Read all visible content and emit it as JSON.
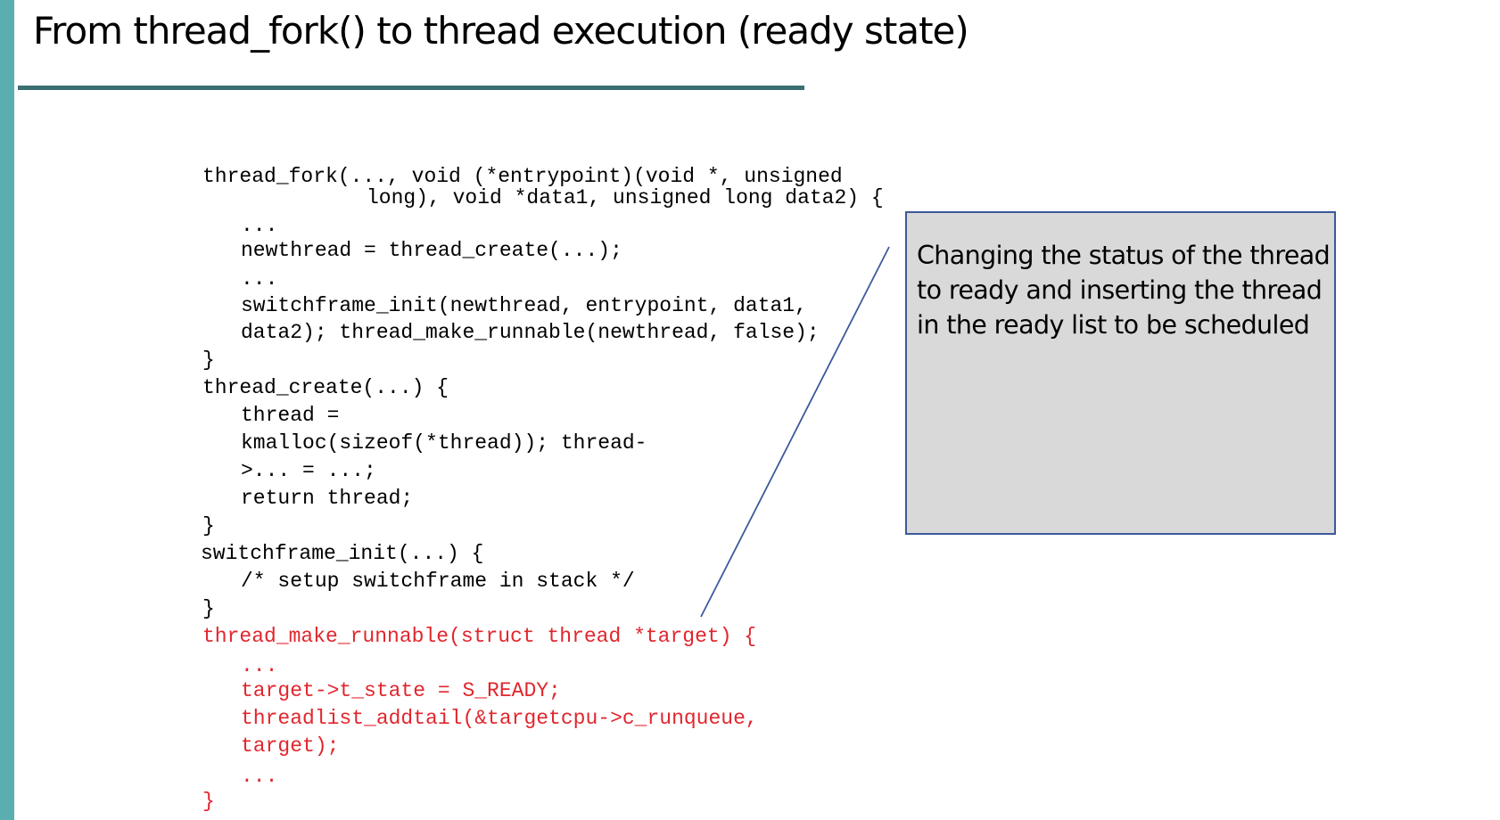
{
  "slide": {
    "title": "From thread_fork() to thread execution (ready state)"
  },
  "code": {
    "lines": [
      "thread_fork(..., void (*entrypoint)(void *, unsigned",
      "long), void *data1, unsigned long data2) {",
      "...",
      "newthread = thread_create(...);",
      "...",
      "switchframe_init(newthread, entrypoint, data1,",
      "data2); thread_make_runnable(newthread, false);",
      "}",
      "thread_create(...) {",
      "thread =",
      "kmalloc(sizeof(*thread)); thread-",
      ">... = ...;",
      "return thread;",
      "}",
      "switchframe_init(...) {",
      "/* setup switchframe in stack */",
      "}",
      "thread_make_runnable(struct thread *target) {",
      "...",
      "target->t_state = S_READY;",
      "threadlist_addtail(&targetcpu->c_runqueue,",
      "target);",
      "...",
      "}"
    ]
  },
  "callout": {
    "line1": "Changing the status of the thread",
    "line2": "to ready and inserting the thread",
    "line3": "in the ready list to be scheduled"
  },
  "colors": {
    "accent_bar": "#5aaeb0",
    "title_rule": "#3a6e72",
    "highlight_code": "#e1262d",
    "callout_fill": "#d9d9d9",
    "callout_border": "#3c5a9a"
  }
}
